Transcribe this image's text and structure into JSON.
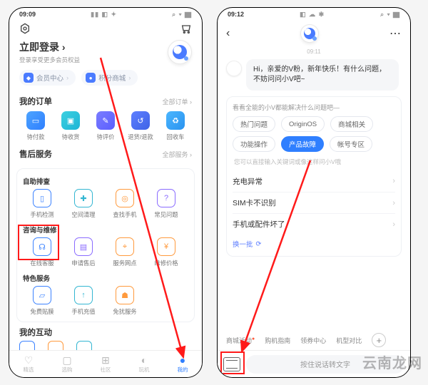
{
  "left": {
    "status_time": "09:09",
    "login_title": "立即登录",
    "login_sub": "登录享受更多会员权益",
    "pill_member": "会员中心",
    "pill_points": "积分商城",
    "orders": {
      "title": "我的订单",
      "more": "全部订单 ›",
      "items": [
        {
          "label": "待付款"
        },
        {
          "label": "待收货"
        },
        {
          "label": "待评价"
        },
        {
          "label": "退货/退款"
        },
        {
          "label": "回收车"
        }
      ]
    },
    "service": {
      "title": "售后服务",
      "more": "全部服务 ›",
      "group1_title": "自助排查",
      "group1": [
        {
          "label": "手机检测"
        },
        {
          "label": "空间清理"
        },
        {
          "label": "查找手机"
        },
        {
          "label": "常见问题"
        }
      ],
      "group2_title": "咨询与维修",
      "group2": [
        {
          "label": "在线客服"
        },
        {
          "label": "申请售后"
        },
        {
          "label": "服务网点"
        },
        {
          "label": "维修价格"
        }
      ],
      "group3_title": "特色服务",
      "group3": [
        {
          "label": "免费贴膜"
        },
        {
          "label": "手机充值"
        },
        {
          "label": "免扰服务"
        }
      ]
    },
    "interact_title": "我的互动",
    "tabs": [
      {
        "label": "精选"
      },
      {
        "label": "选购"
      },
      {
        "label": "社区"
      },
      {
        "label": "玩机"
      },
      {
        "label": "我的"
      }
    ]
  },
  "right": {
    "status_time": "09:12",
    "chat_time": "09:11",
    "greeting": "Hi，亲爱的V粉，新年快乐！有什么问题，不妨问问小V吧~",
    "help_title": "看看全能的小V都能解决什么问题吧—",
    "chips": [
      {
        "label": "热门问题"
      },
      {
        "label": "OriginOS"
      },
      {
        "label": "商城相关"
      },
      {
        "label": "功能操作"
      },
      {
        "label": "产品故障"
      },
      {
        "label": "帐号专区"
      }
    ],
    "chip_active_index": 4,
    "hint": "您可以直接输入关键词或像这样问小V哦",
    "links": [
      {
        "label": "充电异常"
      },
      {
        "label": "SIM卡不识别"
      },
      {
        "label": "手机或配件坏了"
      }
    ],
    "refresh": "换一批",
    "quick": [
      {
        "label": "商城活动"
      },
      {
        "label": "购机指南"
      },
      {
        "label": "领券中心"
      },
      {
        "label": "机型对比"
      }
    ],
    "voice_placeholder": "按住说话转文字"
  },
  "watermark": "云南龙网"
}
